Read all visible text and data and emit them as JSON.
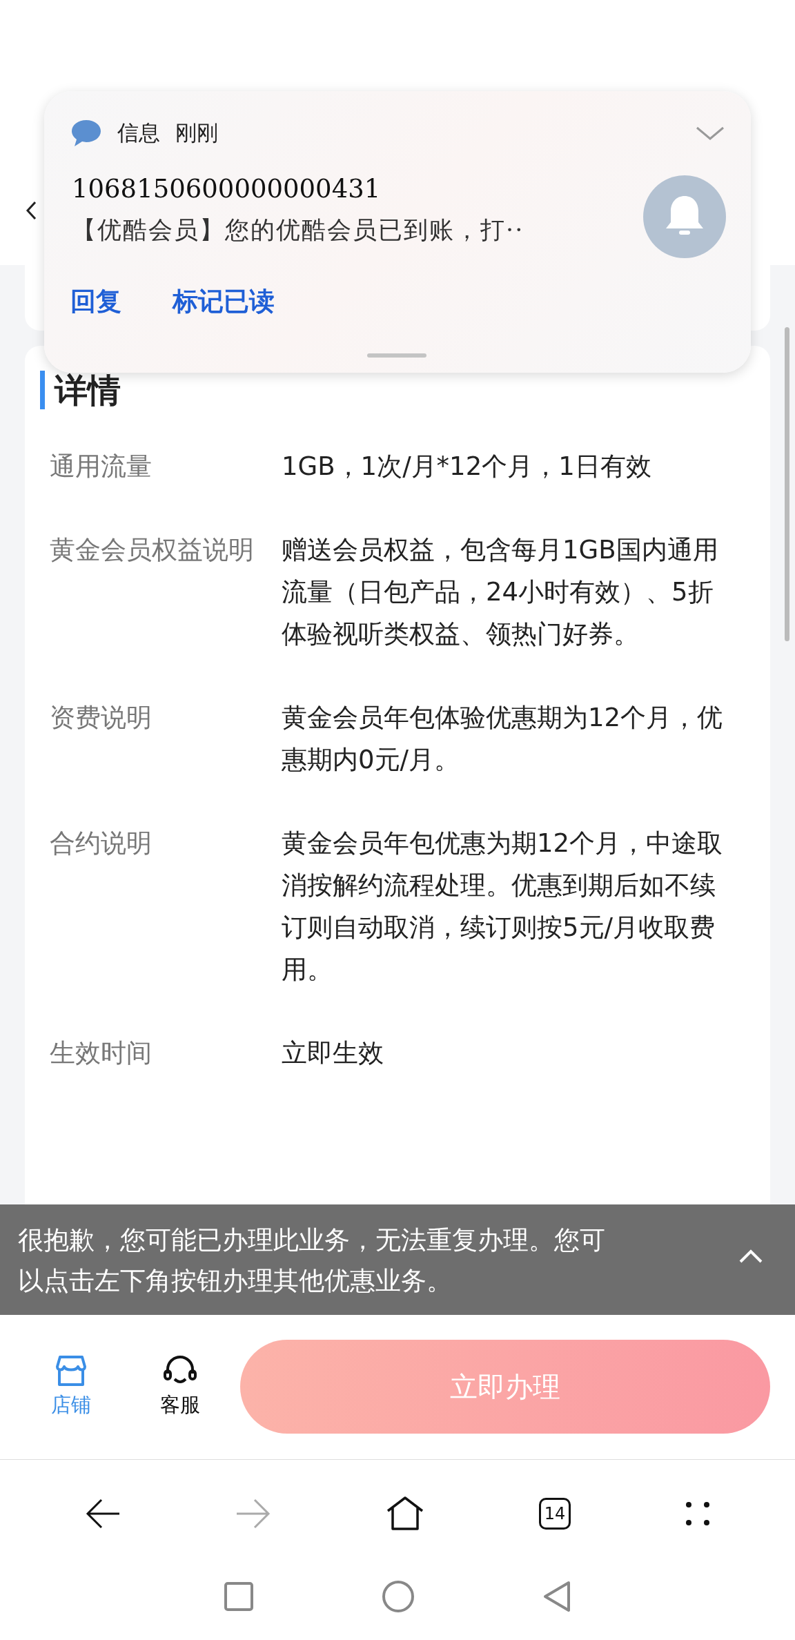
{
  "notification": {
    "app": "信息",
    "time": "刚刚",
    "sender": "1068150600000000431",
    "preview": "【优酷会员】您的优酷会员已到账，打··",
    "actions": [
      "回复",
      "标记已读"
    ]
  },
  "details": {
    "title": "详情",
    "rows": [
      {
        "label": "通用流量",
        "value": "1GB，1次/月*12个月，1日有效"
      },
      {
        "label": "黄金会员权益说明",
        "value": "赠送会员权益，包含每月1GB国内通用流量（日包产品，24小时有效）、5折体验视听类权益、领热门好券。"
      },
      {
        "label": "资费说明",
        "value": "黄金会员年包体验优惠期为12个月，优惠期内0元/月。"
      },
      {
        "label": "合约说明",
        "value": "黄金会员年包优惠为期12个月，中途取消按解约流程处理。优惠到期后如不续订则自动取消，续订则按5元/月收取费用。"
      },
      {
        "label": "生效时间",
        "value": "立即生效"
      }
    ]
  },
  "toast": {
    "text": "很抱歉，您可能已办理此业务，无法重复办理。您可以点击左下角按钮办理其他优惠业务。"
  },
  "action_bar": {
    "items": [
      {
        "kind": "store",
        "label": "店铺",
        "selected": true
      },
      {
        "kind": "service",
        "label": "客服",
        "selected": false
      }
    ],
    "primary_button": "立即办理"
  },
  "browser_nav": {
    "forward_disabled": true,
    "tab_count": "14"
  }
}
